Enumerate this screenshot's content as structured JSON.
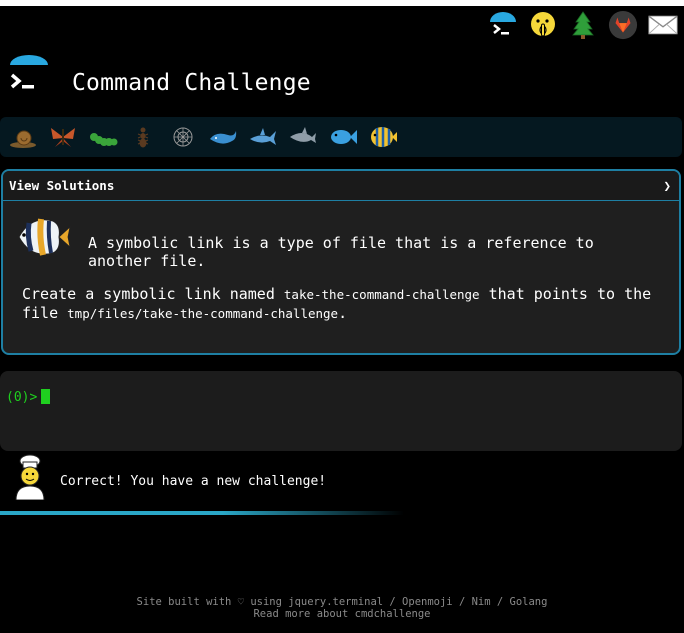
{
  "header": {
    "title": "Command Challenge"
  },
  "top_icons": [
    "cmdchallenge-icon",
    "shushing-face-icon",
    "tree-icon",
    "gitlab-icon",
    "envelope-icon"
  ],
  "creatures": [
    "snail-icon",
    "butterfly-icon",
    "caterpillar-icon",
    "ant-icon",
    "spider-web-icon",
    "whale-icon",
    "shark-icon",
    "dolphin-icon",
    "fish-icon",
    "tropical-fish-icon"
  ],
  "panel": {
    "header_label": "View Solutions",
    "toggle_glyph": "❯",
    "description": "A symbolic link is a type of file that is a reference to another file.",
    "task_prefix": "Create a symbolic link named ",
    "task_code1": "take-the-command-challenge",
    "task_middle": " that points to the file ",
    "task_code2": "tmp/files/take-the-command-challenge",
    "task_suffix": "."
  },
  "terminal": {
    "prompt": "(0)>"
  },
  "message": {
    "text": "Correct! You have a new challenge!"
  },
  "footer": {
    "line1": "Site built with ♡ using jquery.terminal / Openmoji / Nim / Golang",
    "line2": "Read more about cmdchallenge"
  },
  "colors": {
    "accent": "#1e7fa3",
    "prompt_green": "#1fd01f",
    "bar_bg": "#051820"
  }
}
